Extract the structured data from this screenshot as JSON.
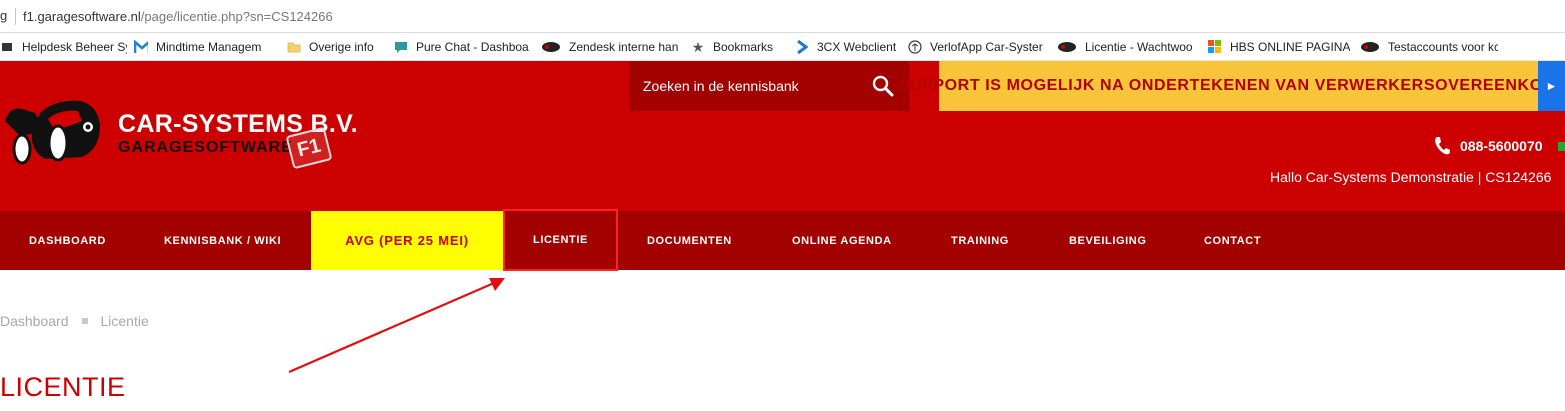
{
  "browser": {
    "address_lead": "g",
    "url_host": "f1.garagesoftware.nl",
    "url_path": "/page/licentie.php?sn=CS124266",
    "bookmarks": [
      {
        "label": "Helpdesk Beheer Sys",
        "icon": "helpdesk-icon"
      },
      {
        "label": "Mindtime Managem",
        "icon": "mindtime-m-icon"
      },
      {
        "label": "Overige info",
        "icon": "folder-icon"
      },
      {
        "label": "Pure Chat - Dashboa",
        "icon": "chat-bubble-icon"
      },
      {
        "label": "Zendesk interne han",
        "icon": "car-systems-icon"
      },
      {
        "label": "Bookmarks",
        "icon": "star-icon"
      },
      {
        "label": "3CX Webclient",
        "icon": "chevron-3cx-icon"
      },
      {
        "label": "VerlofApp Car-Syster",
        "icon": "palm-icon"
      },
      {
        "label": "Licentie - Wachtwoo",
        "icon": "car-systems-icon"
      },
      {
        "label": "HBS ONLINE PAGINA",
        "icon": "windows-icon"
      },
      {
        "label": "Testaccounts voor kc",
        "icon": "car-systems-icon"
      }
    ]
  },
  "header": {
    "brand_title": "CAR-SYSTEMS B.V.",
    "brand_subtitle": "GARAGESOFTWARE",
    "badge": "F1",
    "search_placeholder": "Zoeken in de kennisbank",
    "banner_text": "SUPPORT IS MOGELIJK NA ONDERTEKENEN VAN VERWERKERSOVEREENKOMST",
    "banner_arrow": "►",
    "phone": "088-5600070",
    "greeting": "Hallo Car-Systems Demonstratie | CS124266"
  },
  "nav": {
    "items": [
      {
        "label": "DASHBOARD"
      },
      {
        "label": "KENNISBANK / WIKI"
      },
      {
        "label": "AVG (PER 25 MEI)"
      },
      {
        "label": "LICENTIE"
      },
      {
        "label": "DOCUMENTEN"
      },
      {
        "label": "ONLINE AGENDA"
      },
      {
        "label": "TRAINING"
      },
      {
        "label": "BEVEILIGING"
      },
      {
        "label": "CONTACT"
      }
    ]
  },
  "breadcrumb": {
    "items": [
      "Dashboard",
      "Licentie"
    ]
  },
  "page": {
    "title": "LICENTIE"
  },
  "colors": {
    "header_red": "#cc0000",
    "nav_dark_red": "#a30000",
    "banner_yellow": "#f8c53a",
    "avg_highlight": "#ffff00",
    "annotation_red": "#ff2020"
  }
}
